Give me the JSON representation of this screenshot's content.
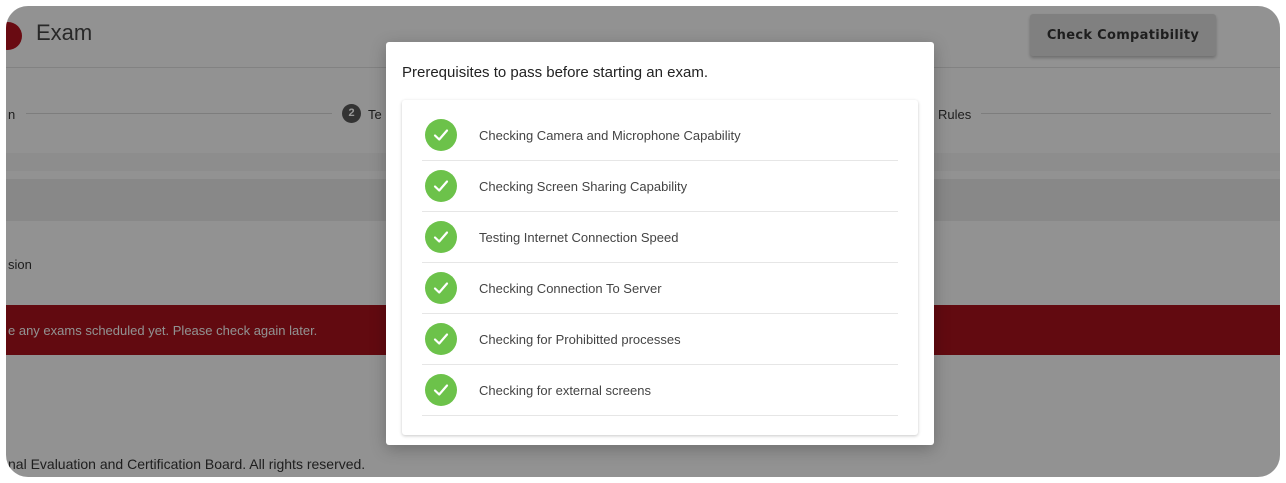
{
  "app": {
    "title": "Exam"
  },
  "header": {
    "check_compatibility_label": "Check Compatibility"
  },
  "stepper": {
    "step1_label": "n",
    "step2_number": "2",
    "step2_label": "Te",
    "step3_label": "Rules"
  },
  "session": {
    "label": "sion"
  },
  "alert": {
    "text": "e any exams scheduled yet. Please check again later."
  },
  "footer": {
    "text": "nal Evaluation and Certification Board. All rights reserved."
  },
  "modal": {
    "title": "Prerequisites to pass before starting an exam.",
    "checks": [
      {
        "label": "Checking Camera and Microphone Capability",
        "status": "passed"
      },
      {
        "label": "Checking Screen Sharing Capability",
        "status": "passed"
      },
      {
        "label": "Testing Internet Connection Speed",
        "status": "passed"
      },
      {
        "label": "Checking Connection To Server",
        "status": "passed"
      },
      {
        "label": "Checking for Prohibitted processes",
        "status": "passed"
      },
      {
        "label": "Checking for external screens",
        "status": "passed"
      }
    ]
  },
  "colors": {
    "brand_red": "#a4121b",
    "success_green": "#6cc24a",
    "overlay": "rgba(0,0,0,0.40)"
  },
  "icons": {
    "check": "check-icon",
    "logo": "logo-icon",
    "step": "step-number-badge"
  }
}
